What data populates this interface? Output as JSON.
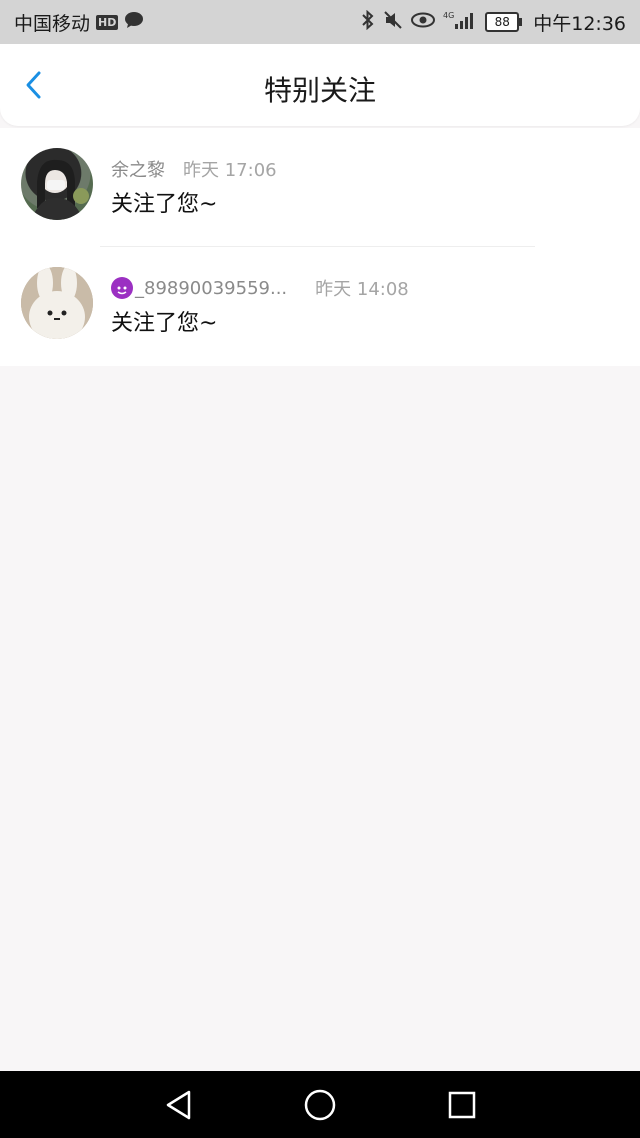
{
  "status_bar": {
    "carrier": "中国移动",
    "hd_label": "HD",
    "network": "4G",
    "battery": "88",
    "time": "中午12:36"
  },
  "header": {
    "title": "特别关注",
    "back_icon": "chevron-left-icon"
  },
  "colors": {
    "accent": "#1a8fe3",
    "timestamp": "#a5a5a5",
    "background": "#f8f6f7"
  },
  "notifications": [
    {
      "name": "余之黎",
      "time": "昨天 17:06",
      "message": "关注了您~"
    },
    {
      "name": "_89890039559...",
      "name_emoji": "devil-emoji",
      "time": "昨天 14:08",
      "message": "关注了您~"
    }
  ],
  "nav_bar": {
    "back": "triangle-back-icon",
    "home": "circle-home-icon",
    "recents": "square-recents-icon"
  }
}
